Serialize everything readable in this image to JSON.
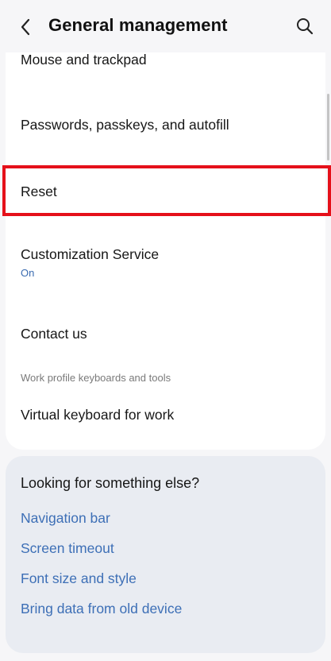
{
  "header": {
    "title": "General management",
    "back_icon": "chevron-left-icon",
    "search_icon": "search-icon"
  },
  "settings_items": [
    {
      "label": "Mouse and trackpad",
      "sub": ""
    },
    {
      "label": "Passwords, passkeys, and autofill",
      "sub": ""
    },
    {
      "label": "Reset",
      "sub": ""
    },
    {
      "label": "Customization Service",
      "sub": "On"
    },
    {
      "label": "Contact us",
      "sub": ""
    },
    {
      "label": "Virtual keyboard for work",
      "sub": ""
    }
  ],
  "section_header": "Work profile keyboards and tools",
  "suggestions": {
    "title": "Looking for something else?",
    "links": [
      "Navigation bar",
      "Screen timeout",
      "Font size and style",
      "Bring data from old device"
    ]
  },
  "colors": {
    "highlight": "#e5101a",
    "link": "#3d6fb6",
    "status_on": "#3a6bb0"
  }
}
